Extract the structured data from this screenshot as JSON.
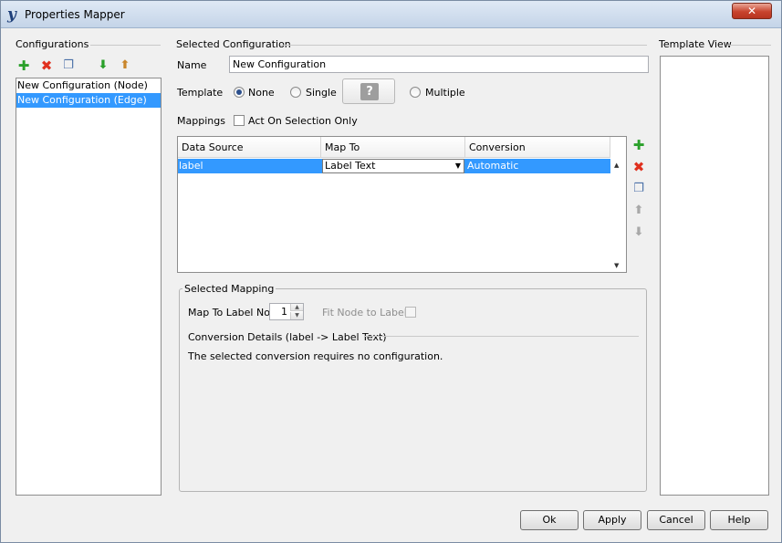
{
  "window": {
    "title": "Properties Mapper",
    "app_icon_glyph": "y",
    "close_glyph": "✕"
  },
  "configurations": {
    "header": "Configurations",
    "toolbar_icons": [
      "add-icon",
      "delete-icon",
      "copy-icon",
      "import-icon",
      "export-icon"
    ],
    "items": [
      {
        "label": "New Configuration (Node)",
        "selected": false
      },
      {
        "label": "New Configuration (Edge)",
        "selected": true
      }
    ]
  },
  "selected_configuration": {
    "header": "Selected Configuration",
    "name_label": "Name",
    "name_value": "New Configuration",
    "template_label": "Template",
    "template_options": [
      {
        "label": "None",
        "checked": true
      },
      {
        "label": "Single",
        "checked": false
      },
      {
        "label": "Multiple",
        "checked": false
      }
    ],
    "template_button_glyph": "?",
    "mappings_label": "Mappings",
    "act_on_selection_label": "Act On Selection Only",
    "act_on_selection_checked": false,
    "table": {
      "columns": [
        "Data Source",
        "Map To",
        "Conversion"
      ],
      "rows": [
        {
          "data_source": "label",
          "map_to": "Label Text",
          "conversion": "Automatic",
          "selected": true
        }
      ]
    },
    "side_icons": [
      "add-icon",
      "delete-icon",
      "copy-icon",
      "move-up-icon",
      "move-down-icon"
    ]
  },
  "selected_mapping": {
    "header": "Selected Mapping",
    "map_to_label_no_label": "Map To Label No.",
    "map_to_label_no_value": "1",
    "fit_node_label": "Fit Node to Label",
    "fit_node_checked": false,
    "conversion_details_header": "Conversion Details (label -> Label Text)",
    "conversion_details_text": "The selected conversion requires no configuration."
  },
  "template_view": {
    "header": "Template View"
  },
  "buttons": {
    "ok": "Ok",
    "apply": "Apply",
    "cancel": "Cancel",
    "help": "Help"
  },
  "colors": {
    "selection": "#3399ff",
    "add_icon": "#2aa02a",
    "delete_icon": "#e0301e"
  }
}
